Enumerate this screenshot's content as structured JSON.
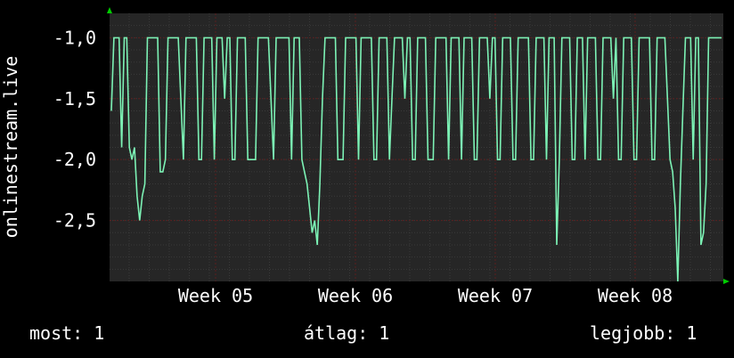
{
  "chart_data": {
    "type": "line",
    "ylabel": "onlinestream.live",
    "x_ticks": [
      "Week 05",
      "Week 06",
      "Week 07",
      "Week 08"
    ],
    "y_ticks": [
      "-1,0",
      "-1,5",
      "-2,0",
      "-2,5"
    ],
    "ylim": [
      -3.0,
      -0.8
    ],
    "grid": true,
    "colors": {
      "background": "#000000",
      "plot_area": "#262626",
      "line": "#7cf2b5",
      "grid_major": "#5a1f1f",
      "grid_minor": "#3a3a3a",
      "axis_arrow": "#00cc00",
      "text": "#ffffff"
    },
    "series": [
      {
        "values": [
          -1.6,
          -1.0,
          -1.0,
          -1.0,
          -1.9,
          -1.0,
          -1.0,
          -1.9,
          -2.0,
          -1.9,
          -2.3,
          -2.5,
          -2.3,
          -2.2,
          -1.0,
          -1.0,
          -1.0,
          -1.0,
          -1.0,
          -2.1,
          -2.1,
          -2.0,
          -1.0,
          -1.0,
          -1.0,
          -1.0,
          -1.0,
          -1.5,
          -2.0,
          -1.0,
          -1.0,
          -1.0,
          -1.0,
          -1.0,
          -2.0,
          -2.0,
          -1.0,
          -1.0,
          -1.0,
          -1.0,
          -2.0,
          -1.0,
          -1.0,
          -1.0,
          -1.5,
          -1.0,
          -1.0,
          -2.0,
          -2.0,
          -1.0,
          -1.0,
          -1.0,
          -1.0,
          -2.0,
          -2.0,
          -2.0,
          -2.0,
          -1.0,
          -1.0,
          -1.0,
          -1.0,
          -1.0,
          -1.5,
          -2.0,
          -1.0,
          -1.0,
          -1.0,
          -1.0,
          -1.0,
          -1.0,
          -2.0,
          -1.0,
          -1.0,
          -1.0,
          -2.0,
          -2.1,
          -2.2,
          -2.4,
          -2.6,
          -2.5,
          -2.7,
          -2.2,
          -1.5,
          -1.0,
          -1.0,
          -1.0,
          -1.0,
          -1.0,
          -2.0,
          -2.0,
          -2.0,
          -1.0,
          -1.0,
          -1.0,
          -1.0,
          -1.0,
          -2.0,
          -1.0,
          -1.0,
          -1.0,
          -1.0,
          -1.0,
          -2.0,
          -2.0,
          -1.0,
          -1.0,
          -1.0,
          -1.0,
          -2.0,
          -1.5,
          -1.0,
          -1.0,
          -1.0,
          -1.0,
          -1.5,
          -1.0,
          -1.0,
          -2.0,
          -2.0,
          -1.0,
          -1.0,
          -1.0,
          -1.0,
          -2.0,
          -2.0,
          -2.0,
          -1.0,
          -1.0,
          -1.0,
          -1.0,
          -1.0,
          -2.0,
          -1.0,
          -1.0,
          -1.0,
          -1.0,
          -2.0,
          -1.0,
          -1.0,
          -1.0,
          -1.0,
          -2.0,
          -2.0,
          -1.0,
          -1.0,
          -1.0,
          -1.0,
          -1.5,
          -1.0,
          -1.0,
          -2.0,
          -2.0,
          -1.0,
          -1.0,
          -1.0,
          -1.0,
          -2.0,
          -2.0,
          -1.0,
          -1.0,
          -1.0,
          -1.0,
          -1.0,
          -2.0,
          -2.0,
          -1.0,
          -1.0,
          -1.0,
          -1.0,
          -2.0,
          -1.0,
          -1.0,
          -1.0,
          -2.7,
          -2.0,
          -1.0,
          -1.0,
          -1.0,
          -1.0,
          -2.0,
          -2.0,
          -1.0,
          -1.0,
          -1.0,
          -2.0,
          -1.0,
          -1.0,
          -1.0,
          -1.0,
          -2.0,
          -2.0,
          -1.0,
          -1.0,
          -1.0,
          -1.0,
          -1.5,
          -1.0,
          -2.0,
          -2.0,
          -1.0,
          -1.0,
          -1.0,
          -1.0,
          -2.0,
          -2.0,
          -1.0,
          -1.0,
          -1.0,
          -1.0,
          -1.0,
          -2.0,
          -2.0,
          -1.0,
          -1.0,
          -1.0,
          -1.0,
          -1.5,
          -2.0,
          -2.1,
          -2.4,
          -3.0,
          -2.2,
          -1.6,
          -1.0,
          -1.0,
          -1.0,
          -2.0,
          -1.0,
          -1.0,
          -2.7,
          -2.6,
          -2.2,
          -1.0,
          -1.0,
          -1.0,
          -1.0,
          -1.0,
          -1.0
        ]
      }
    ]
  },
  "footer": {
    "now_label": "most: 1",
    "avg_label": "átlag: 1",
    "max_label": "legjobb: 1"
  }
}
